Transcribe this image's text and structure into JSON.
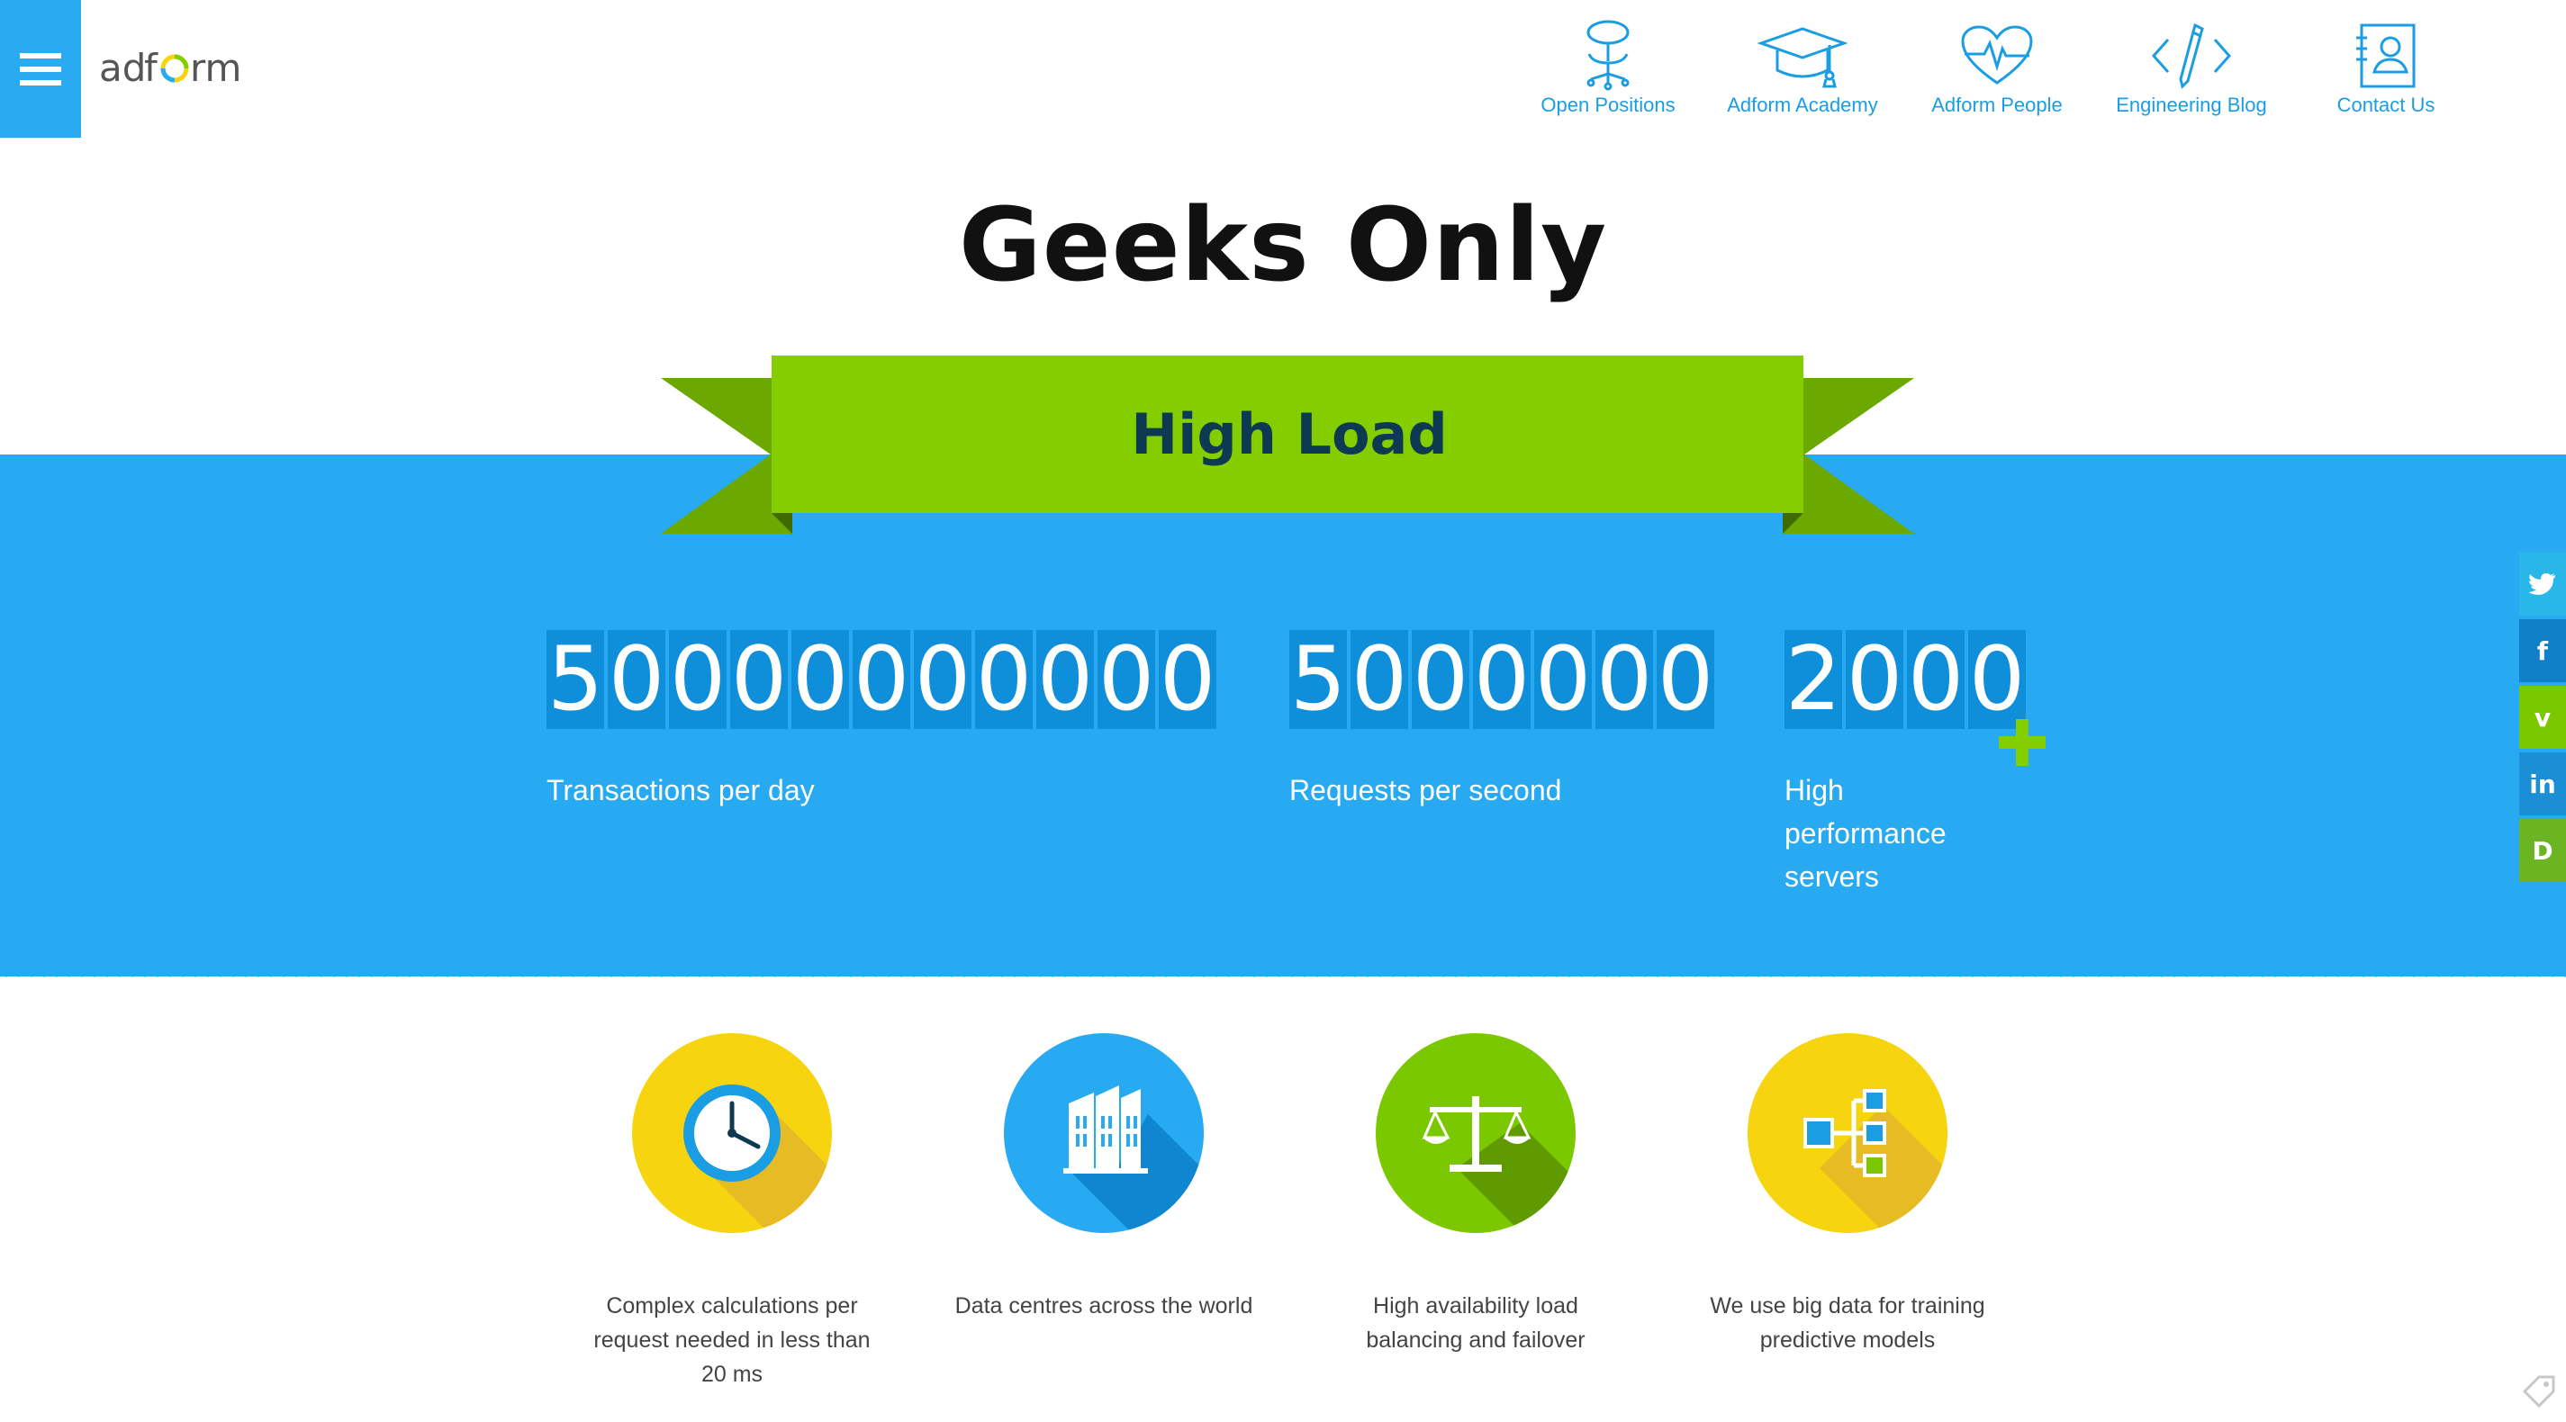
{
  "header": {
    "logo_text": "adform",
    "nav": [
      {
        "label": "Open Positions",
        "icon": "chair-icon"
      },
      {
        "label": "Adform Academy",
        "icon": "graduation-cap-icon"
      },
      {
        "label": "Adform People",
        "icon": "heart-pulse-icon"
      },
      {
        "label": "Engineering Blog",
        "icon": "code-pencil-icon"
      },
      {
        "label": "Contact Us",
        "icon": "contact-card-icon"
      }
    ]
  },
  "title": "Geeks Only",
  "ribbon": "High Load",
  "stats": [
    {
      "digits": [
        "5",
        "0",
        "0",
        "0",
        "0",
        "0",
        "0",
        "0",
        "0",
        "0",
        "0"
      ],
      "label": "Transactions per day"
    },
    {
      "digits": [
        "5",
        "0",
        "0",
        "0",
        "0",
        "0",
        "0"
      ],
      "label": "Requests per second"
    },
    {
      "digits": [
        "2",
        "0",
        "0",
        "0"
      ],
      "label": "High performance servers"
    }
  ],
  "features": [
    {
      "text": "Complex calculations per request needed in less than 20 ms",
      "icon": "clock-icon",
      "color": "#f6d40f"
    },
    {
      "text": "Data centres across the world",
      "icon": "buildings-icon",
      "color": "#27aaf1"
    },
    {
      "text": "High availability load balancing and failover",
      "icon": "scales-icon",
      "color": "#7cc800"
    },
    {
      "text": "We use big data for training predictive models",
      "icon": "flowchart-icon",
      "color": "#f6d40f"
    }
  ],
  "social": [
    {
      "icon": "twitter-icon",
      "glyph": "t",
      "color": "#29b7ea"
    },
    {
      "icon": "facebook-icon",
      "glyph": "f",
      "color": "#1080c8"
    },
    {
      "icon": "vimeo-icon",
      "glyph": "v",
      "color": "#7cc800"
    },
    {
      "icon": "linkedin-icon",
      "glyph": "in",
      "color": "#1a8fd6"
    },
    {
      "icon": "blog-icon",
      "glyph": "D",
      "color": "#6ab521"
    }
  ],
  "colors": {
    "accent_blue": "#27aaf1",
    "digit_bg": "#0f8ed9",
    "ribbon_green": "#84ce00",
    "ribbon_dark_green": "#5e9a00",
    "nav_blue": "#1b9de3"
  }
}
